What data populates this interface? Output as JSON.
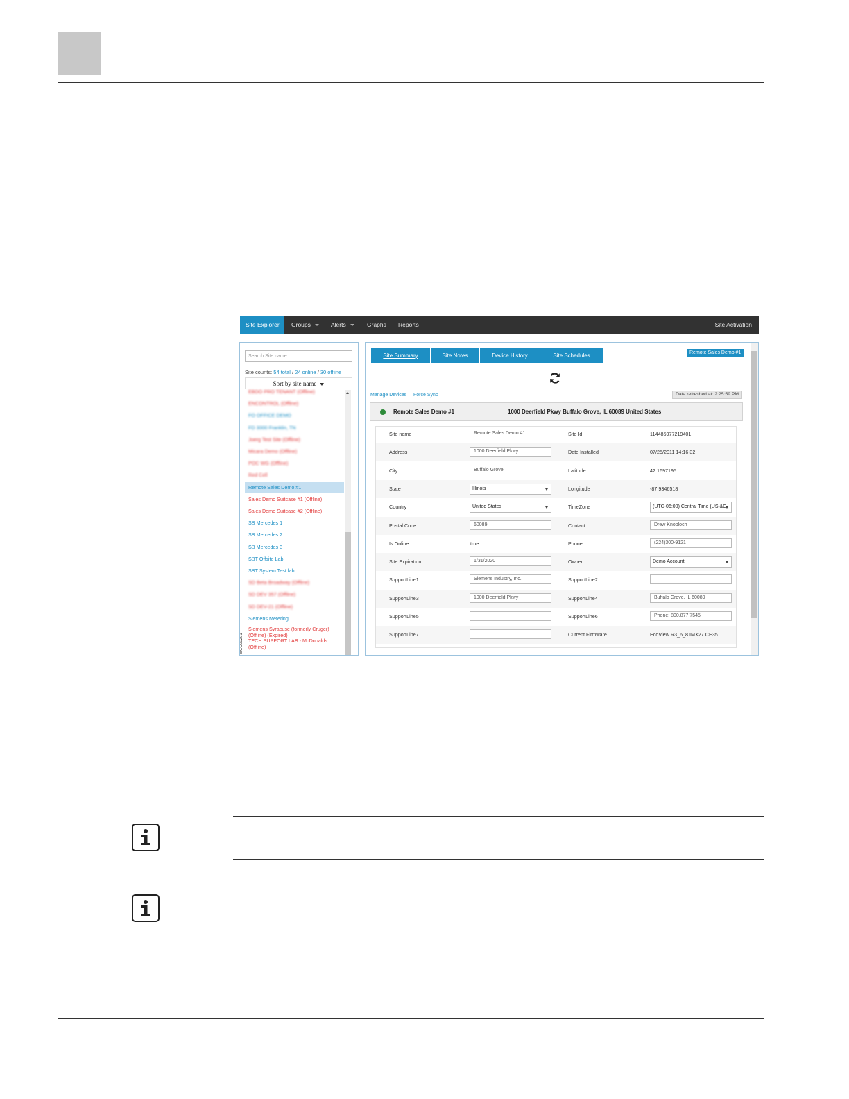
{
  "nav": {
    "items": [
      {
        "label": "Site Explorer",
        "active": true
      },
      {
        "label": "Groups",
        "dropdown": true
      },
      {
        "label": "Alerts",
        "dropdown": true
      },
      {
        "label": "Graphs"
      },
      {
        "label": "Reports"
      }
    ],
    "right_label": "Site Activation"
  },
  "left_panel": {
    "search_placeholder": "Search Site name",
    "counts": {
      "prefix": "Site counts: ",
      "total": "54 total",
      "sep1": " / ",
      "online": "24 online",
      "sep2": " / ",
      "offline": "30 offline"
    },
    "sort_label": "Sort by site name",
    "sites": [
      {
        "label": "EBDO PRO TENANT (Offline)",
        "color": "#e23b3b",
        "blur": true
      },
      {
        "label": "ENCONTROL (Offline)",
        "color": "#e23b3b",
        "blur": true
      },
      {
        "label": "FO OFFICE DEMO",
        "color": "#1d8fc4",
        "blur": true
      },
      {
        "label": "FD 3000 Franklin, TN",
        "color": "#1d8fc4",
        "blur": true
      },
      {
        "label": "Joerg Test Site (Offline)",
        "color": "#e23b3b",
        "blur": true
      },
      {
        "label": "Micara Demo (Offline)",
        "color": "#e23b3b",
        "blur": true
      },
      {
        "label": "POC WG (Offline)",
        "color": "#e23b3b",
        "blur": true
      },
      {
        "label": "Red Cell",
        "color": "#e23b3b",
        "blur": true
      },
      {
        "label": "Remote Sales Demo #1",
        "color": "#1d8fc4",
        "selected": true
      },
      {
        "label": "Sales Demo Suitcase #1 (Offline)",
        "color": "#e23b3b"
      },
      {
        "label": "Sales Demo Suitcase #2 (Offline)",
        "color": "#e23b3b"
      },
      {
        "label": "SB Mercedes 1",
        "color": "#1d8fc4"
      },
      {
        "label": "SB Mercedes 2",
        "color": "#1d8fc4"
      },
      {
        "label": "SB Mercedes 3",
        "color": "#1d8fc4"
      },
      {
        "label": "SBT Offsite Lab",
        "color": "#1d8fc4"
      },
      {
        "label": "SBT System Test lab",
        "color": "#1d8fc4"
      },
      {
        "label": "SD Beta Broadway (Offline)",
        "color": "#e23b3b",
        "blur": true
      },
      {
        "label": "SD DEV 357 (Offline)",
        "color": "#e23b3b",
        "blur": true
      },
      {
        "label": "SD DEV-21 (Offline)",
        "color": "#e23b3b",
        "blur": true
      },
      {
        "label": "Siemens Metering",
        "color": "#1d8fc4"
      },
      {
        "label": "Siemens Syracuse (formerly Cruger)",
        "label2": "(Offline) (Expired)",
        "color": "#e23b3b"
      },
      {
        "label": "TECH SUPPORT LAB - McDonalds",
        "label2": "(Offline)",
        "color": "#e23b3b"
      }
    ],
    "figure_id": "ECO00291"
  },
  "right_panel": {
    "tabs": [
      {
        "label": "Site Summary",
        "active": true
      },
      {
        "label": "Site Notes"
      },
      {
        "label": "Device History"
      },
      {
        "label": "Site Schedules"
      }
    ],
    "site_badge": "Remote Sales Demo #1",
    "manage_devices": "Manage Devices",
    "force_sync": "Force Sync",
    "data_refreshed": "Data refreshed at: 2:25:59 PM",
    "header": {
      "name": "Remote Sales Demo #1",
      "address": "1000 Deerfield Pkwy Buffalo Grove, IL 60089 United States"
    },
    "rows": [
      {
        "l1": "Site name",
        "v1": "Remote Sales Demo #1",
        "t1": "input",
        "l2": "Site Id",
        "v2": "114485977219401",
        "t2": "text"
      },
      {
        "l1": "Address",
        "v1": "1000 Deerfield Pkwy",
        "t1": "input",
        "l2": "Date Installed",
        "v2": "07/25/2011 14:16:32",
        "t2": "text"
      },
      {
        "l1": "City",
        "v1": "Buffalo Grove",
        "t1": "input",
        "l2": "Latitude",
        "v2": "42.1697195",
        "t2": "text"
      },
      {
        "l1": "State",
        "v1": "Illinois",
        "t1": "select",
        "l2": "Longitude",
        "v2": "-87.9346518",
        "t2": "text"
      },
      {
        "l1": "Country",
        "v1": "United States",
        "t1": "select",
        "l2": "TimeZone",
        "v2": "(UTC-06:00) Central Time (US &C",
        "t2": "select"
      },
      {
        "l1": "Postal Code",
        "v1": "60089",
        "t1": "input",
        "l2": "Contact",
        "v2": "Drew Knobloch",
        "t2": "input"
      },
      {
        "l1": "Is Online",
        "v1": "true",
        "t1": "text",
        "l2": "Phone",
        "v2": "(224)300-9121",
        "t2": "input"
      },
      {
        "l1": "Site Expiration",
        "v1": "1/31/2020",
        "t1": "input",
        "l2": "Owner",
        "v2": "Demo Account",
        "t2": "select"
      },
      {
        "l1": "SupportLine1",
        "v1": "Siemens Industry, Inc.",
        "t1": "input",
        "l2": "SupportLine2",
        "v2": "",
        "t2": "input"
      },
      {
        "l1": "SupportLine3",
        "v1": "1000 Deerfield Pkwy",
        "t1": "input",
        "l2": "SupportLine4",
        "v2": "Buffalo Grove, IL 60089",
        "t2": "input"
      },
      {
        "l1": "SupportLine5",
        "v1": "",
        "t1": "input",
        "l2": "SupportLine6",
        "v2": "Phone: 800.877.7545",
        "t2": "input"
      },
      {
        "l1": "SupportLine7",
        "v1": "",
        "t1": "input",
        "l2": "Current Firmware",
        "v2": "EcoView R3_6_8 IMX27 CE35",
        "t2": "text"
      }
    ]
  }
}
